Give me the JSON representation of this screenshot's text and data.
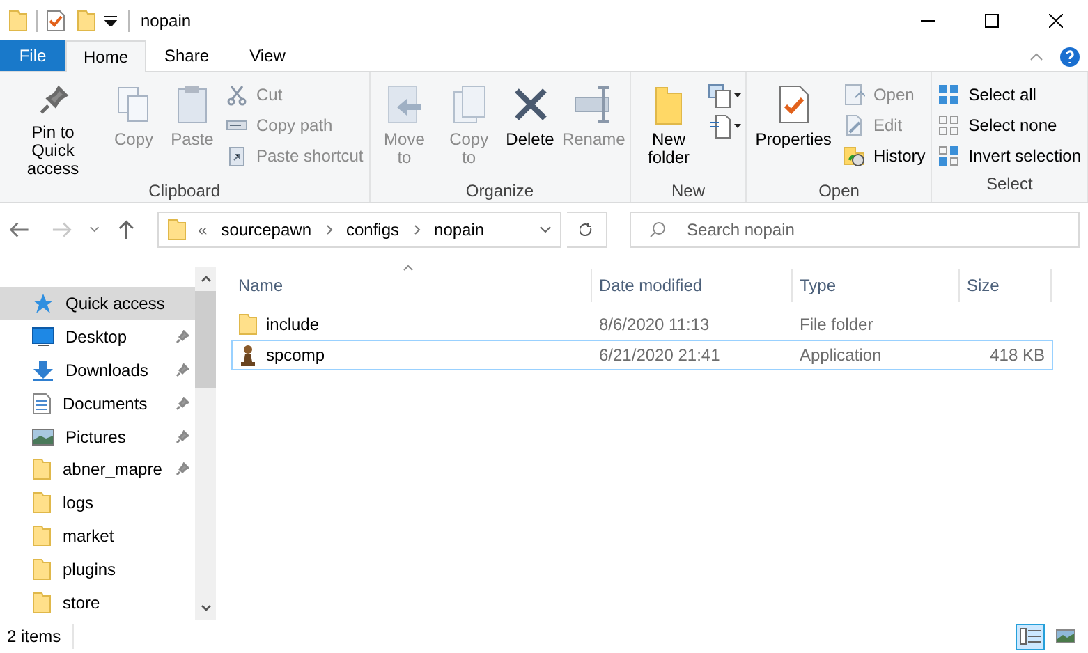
{
  "window": {
    "title": "nopain"
  },
  "tabs": [
    {
      "label": "File",
      "kind": "file",
      "selected": false
    },
    {
      "label": "Home",
      "kind": "tab",
      "selected": true
    },
    {
      "label": "Share",
      "kind": "tab",
      "selected": false
    },
    {
      "label": "View",
      "kind": "tab",
      "selected": false
    }
  ],
  "ribbon": [
    {
      "label": "Clipboard",
      "buttons": [
        {
          "kind": "large",
          "label": "Pin to Quick access",
          "disabled": false
        },
        {
          "kind": "large",
          "label": "Copy",
          "disabled": true
        },
        {
          "kind": "large",
          "label": "Paste",
          "disabled": true
        },
        {
          "kind": "stack",
          "items": [
            {
              "label": "Cut",
              "disabled": true
            },
            {
              "label": "Copy path",
              "disabled": true
            },
            {
              "label": "Paste shortcut",
              "disabled": true
            }
          ]
        }
      ]
    },
    {
      "label": "Organize",
      "buttons": [
        {
          "kind": "large",
          "label": "Move to",
          "disabled": true
        },
        {
          "kind": "large",
          "label": "Copy to",
          "disabled": true
        },
        {
          "kind": "large",
          "label": "Delete",
          "disabled": false
        },
        {
          "kind": "large",
          "label": "Rename",
          "disabled": true
        }
      ]
    },
    {
      "label": "New",
      "buttons": [
        {
          "kind": "large",
          "label": "New folder",
          "disabled": false
        },
        {
          "kind": "minis"
        }
      ]
    },
    {
      "label": "Open",
      "buttons": [
        {
          "kind": "large",
          "label": "Properties",
          "disabled": false
        },
        {
          "kind": "stack",
          "items": [
            {
              "label": "Open",
              "disabled": true
            },
            {
              "label": "Edit",
              "disabled": true
            },
            {
              "label": "History",
              "disabled": false
            }
          ]
        }
      ]
    },
    {
      "label": "Select",
      "buttons": [
        {
          "kind": "stack",
          "items": [
            {
              "label": "Select all",
              "disabled": false
            },
            {
              "label": "Select none",
              "disabled": false
            },
            {
              "label": "Invert selection",
              "disabled": false
            }
          ]
        }
      ]
    }
  ],
  "navigation": {
    "back_disabled": false,
    "forward_disabled": true
  },
  "address": {
    "overflow": "«",
    "crumbs": [
      "sourcepawn",
      "configs",
      "nopain"
    ]
  },
  "search": {
    "placeholder": "Search nopain"
  },
  "sidebar": {
    "items": [
      {
        "label": "Quick access",
        "kind": "quickaccess",
        "pinned": false,
        "selected": true
      },
      {
        "label": "Desktop",
        "kind": "desktop",
        "pinned": true,
        "selected": false
      },
      {
        "label": "Downloads",
        "kind": "downloads",
        "pinned": true,
        "selected": false
      },
      {
        "label": "Documents",
        "kind": "documents",
        "pinned": true,
        "selected": false
      },
      {
        "label": "Pictures",
        "kind": "pictures",
        "pinned": true,
        "selected": false
      },
      {
        "label": "abner_mapre",
        "kind": "folder",
        "pinned": true,
        "selected": false
      },
      {
        "label": "logs",
        "kind": "folder",
        "pinned": false,
        "selected": false
      },
      {
        "label": "market",
        "kind": "folder",
        "pinned": false,
        "selected": false
      },
      {
        "label": "plugins",
        "kind": "folder",
        "pinned": false,
        "selected": false
      },
      {
        "label": "store",
        "kind": "folder",
        "pinned": false,
        "selected": false
      }
    ]
  },
  "table": {
    "columns": [
      "Name",
      "Date modified",
      "Type",
      "Size"
    ],
    "rows": [
      {
        "kind": "folder",
        "focused": false,
        "cells": [
          "include",
          "8/6/2020 11:13",
          "File folder",
          ""
        ]
      },
      {
        "kind": "application",
        "focused": true,
        "cells": [
          "spcomp",
          "6/21/2020 21:41",
          "Application",
          "418 KB"
        ]
      }
    ]
  },
  "status_bar": {
    "text": "2 items"
  },
  "views": [
    {
      "kind": "details",
      "selected": true
    },
    {
      "kind": "large_icons",
      "selected": false
    }
  ]
}
